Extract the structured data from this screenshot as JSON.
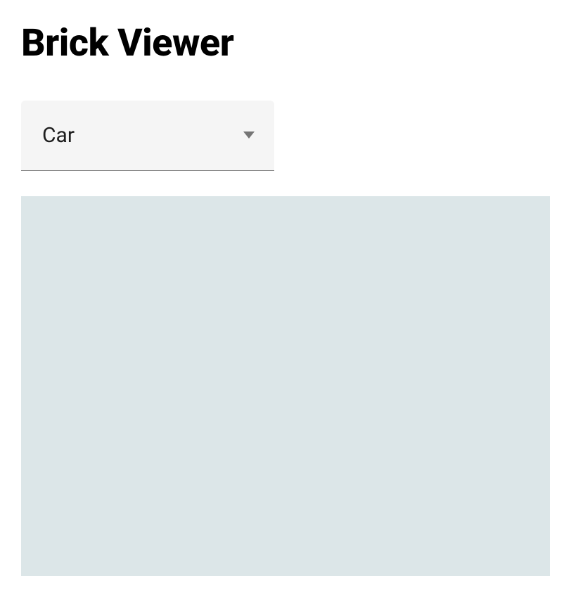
{
  "header": {
    "title": "Brick Viewer"
  },
  "dropdown": {
    "selected": "Car"
  }
}
